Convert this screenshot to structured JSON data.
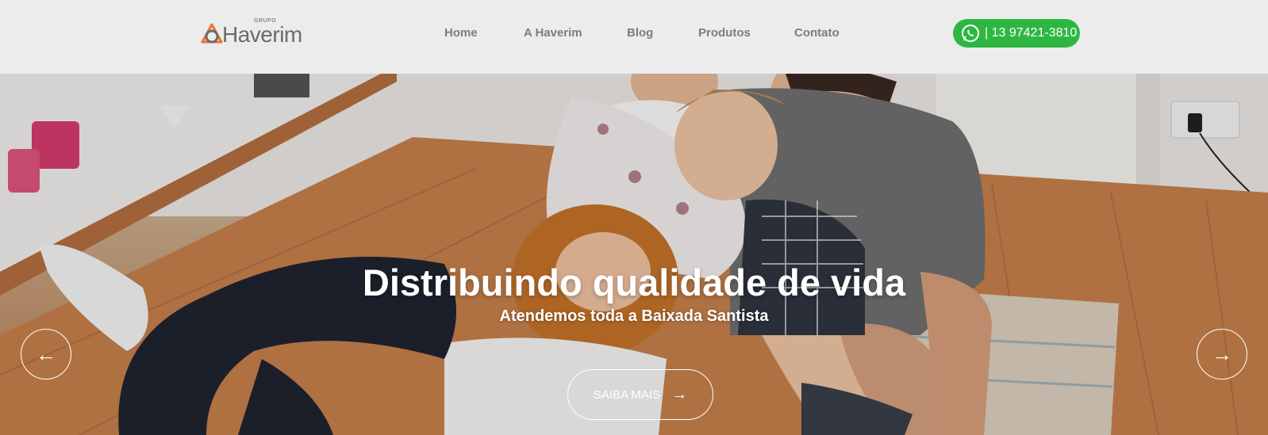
{
  "brand": {
    "grupo": "GRUPO",
    "name": "Haverim",
    "accent_color": "#e8742a"
  },
  "nav": {
    "items": [
      {
        "label": "Home"
      },
      {
        "label": "A Haverim"
      },
      {
        "label": "Blog"
      },
      {
        "label": "Produtos"
      },
      {
        "label": "Contato"
      }
    ]
  },
  "whatsapp": {
    "label": "| 13 97421-3810",
    "icon": "whatsapp-icon",
    "color": "#2db742"
  },
  "hero": {
    "title": "Distribuindo qualidade de vida",
    "subtitle": "Atendemos toda a Baixada Santista",
    "cta_label": "SAIBA MAIS",
    "cta_icon": "arrow-right-icon",
    "prev_icon": "arrow-left-icon",
    "next_icon": "arrow-right-icon",
    "image": "family-playing-on-floor-photo"
  }
}
